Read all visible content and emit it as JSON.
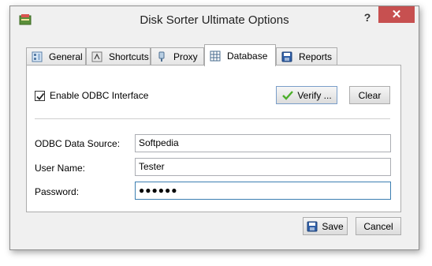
{
  "window": {
    "title": "Disk Sorter Ultimate Options",
    "help_label": "?",
    "close_label": "✕"
  },
  "tabs": [
    {
      "label": "General",
      "icon": "general-icon"
    },
    {
      "label": "Shortcuts",
      "icon": "shortcuts-icon"
    },
    {
      "label": "Proxy",
      "icon": "proxy-icon"
    },
    {
      "label": "Database",
      "icon": "database-icon",
      "active": true
    },
    {
      "label": "Reports",
      "icon": "reports-icon"
    }
  ],
  "database": {
    "enable_odbc_label": "Enable ODBC Interface",
    "enable_odbc_checked": true,
    "verify_label": "Verify ...",
    "clear_label": "Clear",
    "fields": {
      "data_source_label": "ODBC Data Source:",
      "data_source_value": "Softpedia",
      "user_name_label": "User Name:",
      "user_name_value": "Tester",
      "password_label": "Password:",
      "password_value": "●●●●●●"
    }
  },
  "footer": {
    "save_label": "Save",
    "cancel_label": "Cancel"
  },
  "colors": {
    "close_button": "#c75050",
    "focus_border": "#3c7fb1"
  }
}
